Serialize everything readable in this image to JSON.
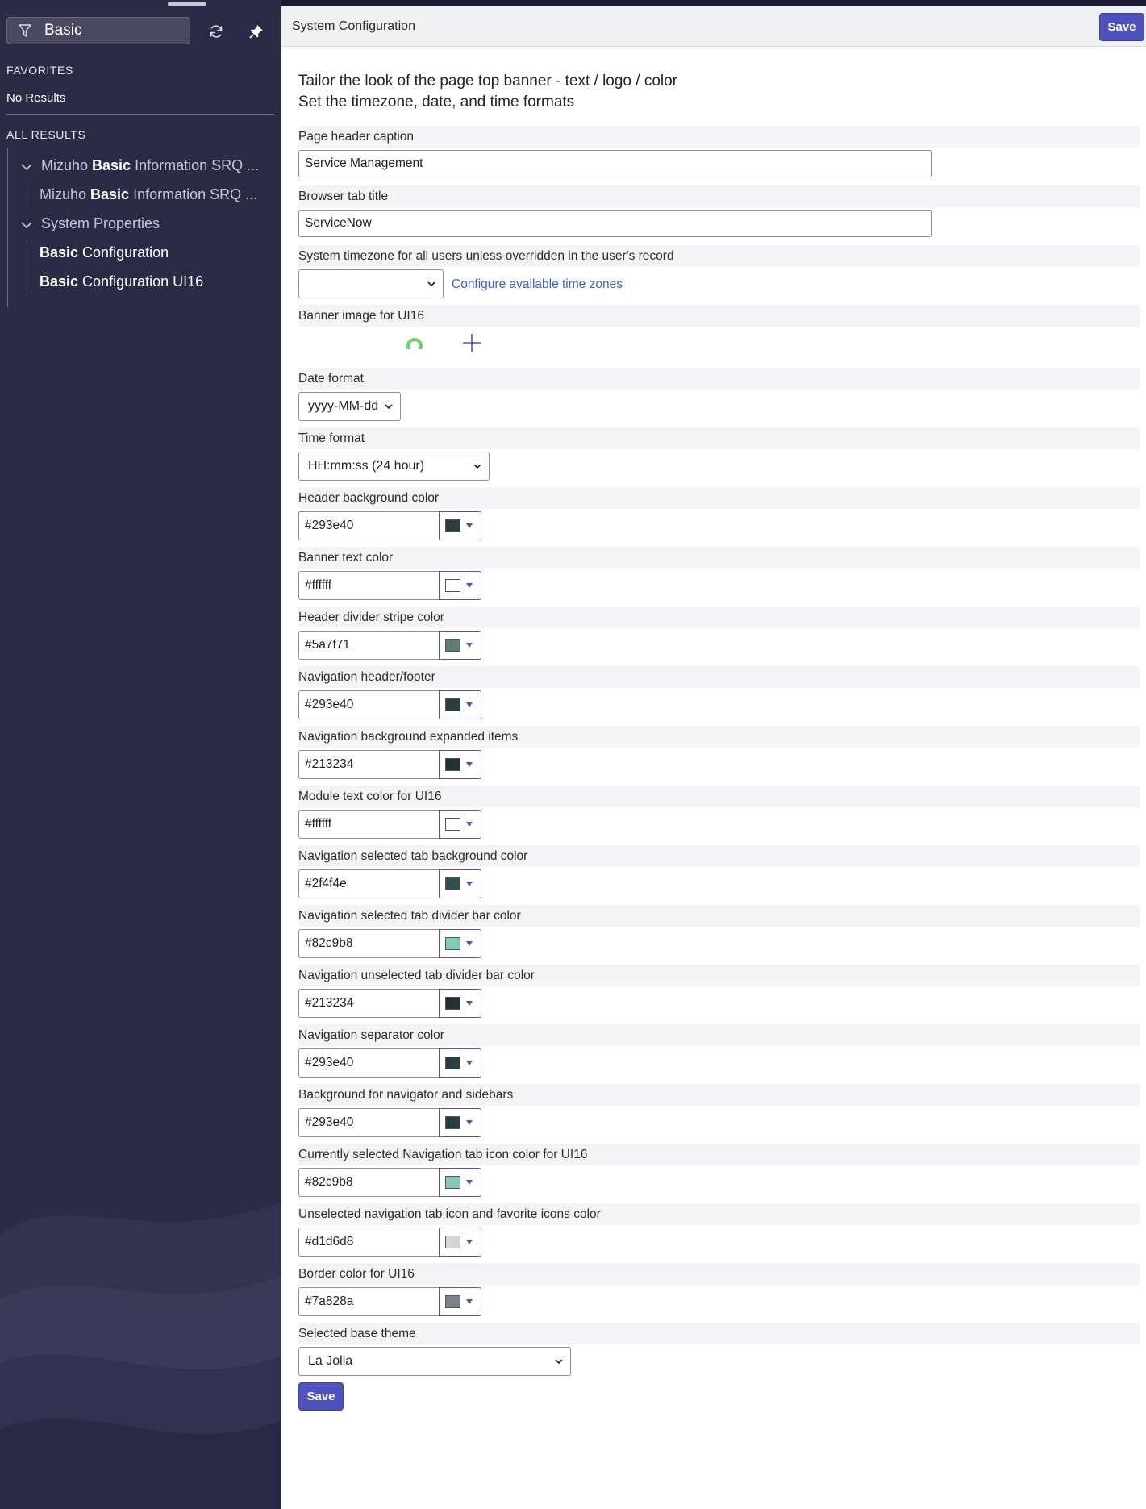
{
  "sidebar": {
    "filter_value": "Basic",
    "icons": {
      "filter": "filter-icon",
      "refresh": "refresh-icon",
      "pin": "pin-icon"
    },
    "favorites_heading": "FAVORITES",
    "favorites_empty": "No Results",
    "all_results_heading": "ALL RESULTS",
    "tree": [
      {
        "pre": "Mizuho ",
        "bold": "Basic",
        "post": " Information SRQ ..."
      },
      {
        "pre": "Mizuho ",
        "bold": "Basic",
        "post": " Information SRQ ..."
      },
      {
        "pre": "System Properties",
        "bold": "",
        "post": ""
      },
      {
        "pre": "",
        "bold": "Basic",
        "post": " Configuration"
      },
      {
        "pre": "",
        "bold": "Basic",
        "post": " Configuration UI16"
      }
    ]
  },
  "header": {
    "title": "System Configuration",
    "save_label": "Save"
  },
  "intro": {
    "line1": "Tailor the look of the page top banner - text / logo / color",
    "line2": "Set the timezone, date, and time formats"
  },
  "fields": {
    "page_header_caption": {
      "label": "Page header caption",
      "value": "Service Management"
    },
    "browser_tab_title": {
      "label": "Browser tab title",
      "value": "ServiceNow"
    },
    "timezone": {
      "label": "System timezone for all users unless overridden in the user's record",
      "value": "",
      "link": "Configure available time zones"
    },
    "banner_image": {
      "label": "Banner image for UI16"
    },
    "date_format": {
      "label": "Date format",
      "value": "yyyy-MM-dd"
    },
    "time_format": {
      "label": "Time format",
      "value": "HH:mm:ss (24 hour)"
    },
    "base_theme": {
      "label": "Selected base theme",
      "value": "La Jolla"
    }
  },
  "colors": [
    {
      "label": "Header background color",
      "value": "#293e40"
    },
    {
      "label": "Banner text color",
      "value": "#ffffff"
    },
    {
      "label": "Header divider stripe color",
      "value": "#5a7f71"
    },
    {
      "label": "Navigation header/footer",
      "value": "#293e40"
    },
    {
      "label": "Navigation background expanded items",
      "value": "#213234"
    },
    {
      "label": "Module text color for UI16",
      "value": "#ffffff"
    },
    {
      "label": "Navigation selected tab background color",
      "value": "#2f4f4e"
    },
    {
      "label": "Navigation selected tab divider bar color",
      "value": "#82c9b8"
    },
    {
      "label": "Navigation unselected tab divider bar color",
      "value": "#213234"
    },
    {
      "label": "Navigation separator color",
      "value": "#293e40"
    },
    {
      "label": "Background for navigator and sidebars",
      "value": "#293e40"
    },
    {
      "label": "Currently selected Navigation tab icon color for UI16",
      "value": "#82c9b8"
    },
    {
      "label": "Unselected navigation tab icon and favorite icons color",
      "value": "#d1d6d8"
    },
    {
      "label": "Border color for UI16",
      "value": "#7a828a"
    }
  ],
  "footer": {
    "save_label": "Save"
  },
  "theme_colors": {
    "accent": "#4f52bd",
    "sidebar_bg": "#2c2b45",
    "link": "#3b5fcc"
  }
}
